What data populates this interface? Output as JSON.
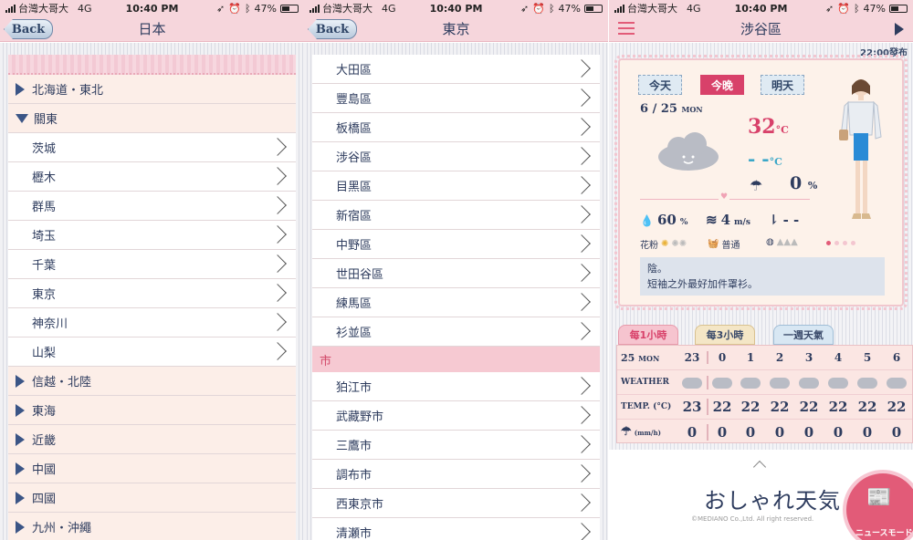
{
  "status": {
    "carrier": "台灣大哥大",
    "network": "4G",
    "time": "10:40 PM",
    "battery": "47%",
    "icons": [
      "signal-icon",
      "location-icon",
      "alarm-icon",
      "bluetooth-icon",
      "battery-icon"
    ]
  },
  "panel1": {
    "back": "Back",
    "title": "日本",
    "rows": [
      {
        "type": "section",
        "label": "北海道・東北",
        "expanded": false
      },
      {
        "type": "section",
        "label": "關東",
        "expanded": true
      },
      {
        "type": "sub",
        "label": "茨城"
      },
      {
        "type": "sub",
        "label": "櫪木"
      },
      {
        "type": "sub",
        "label": "群馬"
      },
      {
        "type": "sub",
        "label": "埼玉"
      },
      {
        "type": "sub",
        "label": "千葉"
      },
      {
        "type": "sub",
        "label": "東京"
      },
      {
        "type": "sub",
        "label": "神奈川"
      },
      {
        "type": "sub",
        "label": "山梨"
      },
      {
        "type": "section",
        "label": "信越・北陸",
        "expanded": false
      },
      {
        "type": "section",
        "label": "東海",
        "expanded": false
      },
      {
        "type": "section",
        "label": "近畿",
        "expanded": false
      },
      {
        "type": "section",
        "label": "中國",
        "expanded": false
      },
      {
        "type": "section",
        "label": "四國",
        "expanded": false
      },
      {
        "type": "section",
        "label": "九州・沖繩",
        "expanded": false
      }
    ]
  },
  "panel2": {
    "back": "Back",
    "title": "東京",
    "wards": [
      "大田區",
      "豐島區",
      "板橋區",
      "涉谷區",
      "目黑區",
      "新宿區",
      "中野區",
      "世田谷區",
      "練馬區",
      "衫並區"
    ],
    "city_header": "市",
    "cities": [
      "狛江市",
      "武藏野市",
      "三鷹市",
      "調布市",
      "西東京市",
      "清瀬市"
    ]
  },
  "panel3": {
    "title": "涉谷區",
    "published": "22:00發布",
    "tabs": [
      {
        "label": "今天",
        "active": false
      },
      {
        "label": "今晚",
        "active": true
      },
      {
        "label": "明天",
        "active": false
      }
    ],
    "date": "6 / 25",
    "date_suffix": "MON",
    "high": "32",
    "low": "- -",
    "unit": "°C",
    "rain": "0",
    "rain_unit": "%",
    "humidity": "60",
    "humidity_unit": "%",
    "wind": "4",
    "wind_unit": "m/s",
    "uv": "- -",
    "pollen_label": "花粉",
    "laundry_label": "普通",
    "advice_line1": "陰。",
    "advice_line2": "短袖之外最好加件罩衫。",
    "forecast_tabs": [
      "每1小時",
      "每3小時",
      "一週天氣"
    ],
    "hourly": {
      "date_label": "25",
      "date_suffix": "MON",
      "hours": [
        "23",
        "0",
        "1",
        "2",
        "3",
        "4",
        "5",
        "6"
      ],
      "weather_label": "WEATHER",
      "temp_label": "TEMP. (°C)",
      "temps": [
        "23",
        "22",
        "22",
        "22",
        "22",
        "22",
        "22",
        "22"
      ],
      "rain_label": "(mm/h)",
      "rain": [
        "0",
        "0",
        "0",
        "0",
        "0",
        "0",
        "0",
        "0"
      ]
    },
    "logo": "おしゃれ天気",
    "copyright": "©MEDIANO Co.,Ltd. All right reserved.",
    "news_label": "ニュースモード"
  }
}
